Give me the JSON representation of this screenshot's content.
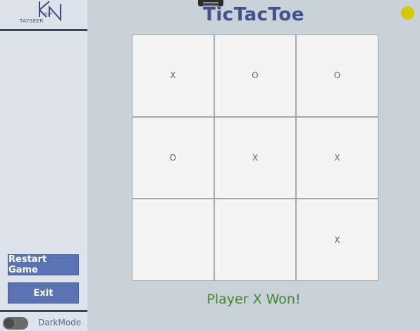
{
  "app": {
    "title": "TicTacToe",
    "logo_text": "TAYSEER",
    "status_color": "#d4c80a"
  },
  "sidebar": {
    "restart_label": "Restart Game",
    "exit_label": "Exit",
    "darkmode_label": "DarkMode",
    "darkmode_on": false
  },
  "board": {
    "cells": [
      [
        "X",
        "O",
        "O"
      ],
      [
        "O",
        "X",
        "X"
      ],
      [
        "",
        "",
        "X"
      ]
    ]
  },
  "result": {
    "message": "Player X Won!",
    "color": "#3e8a2e"
  }
}
